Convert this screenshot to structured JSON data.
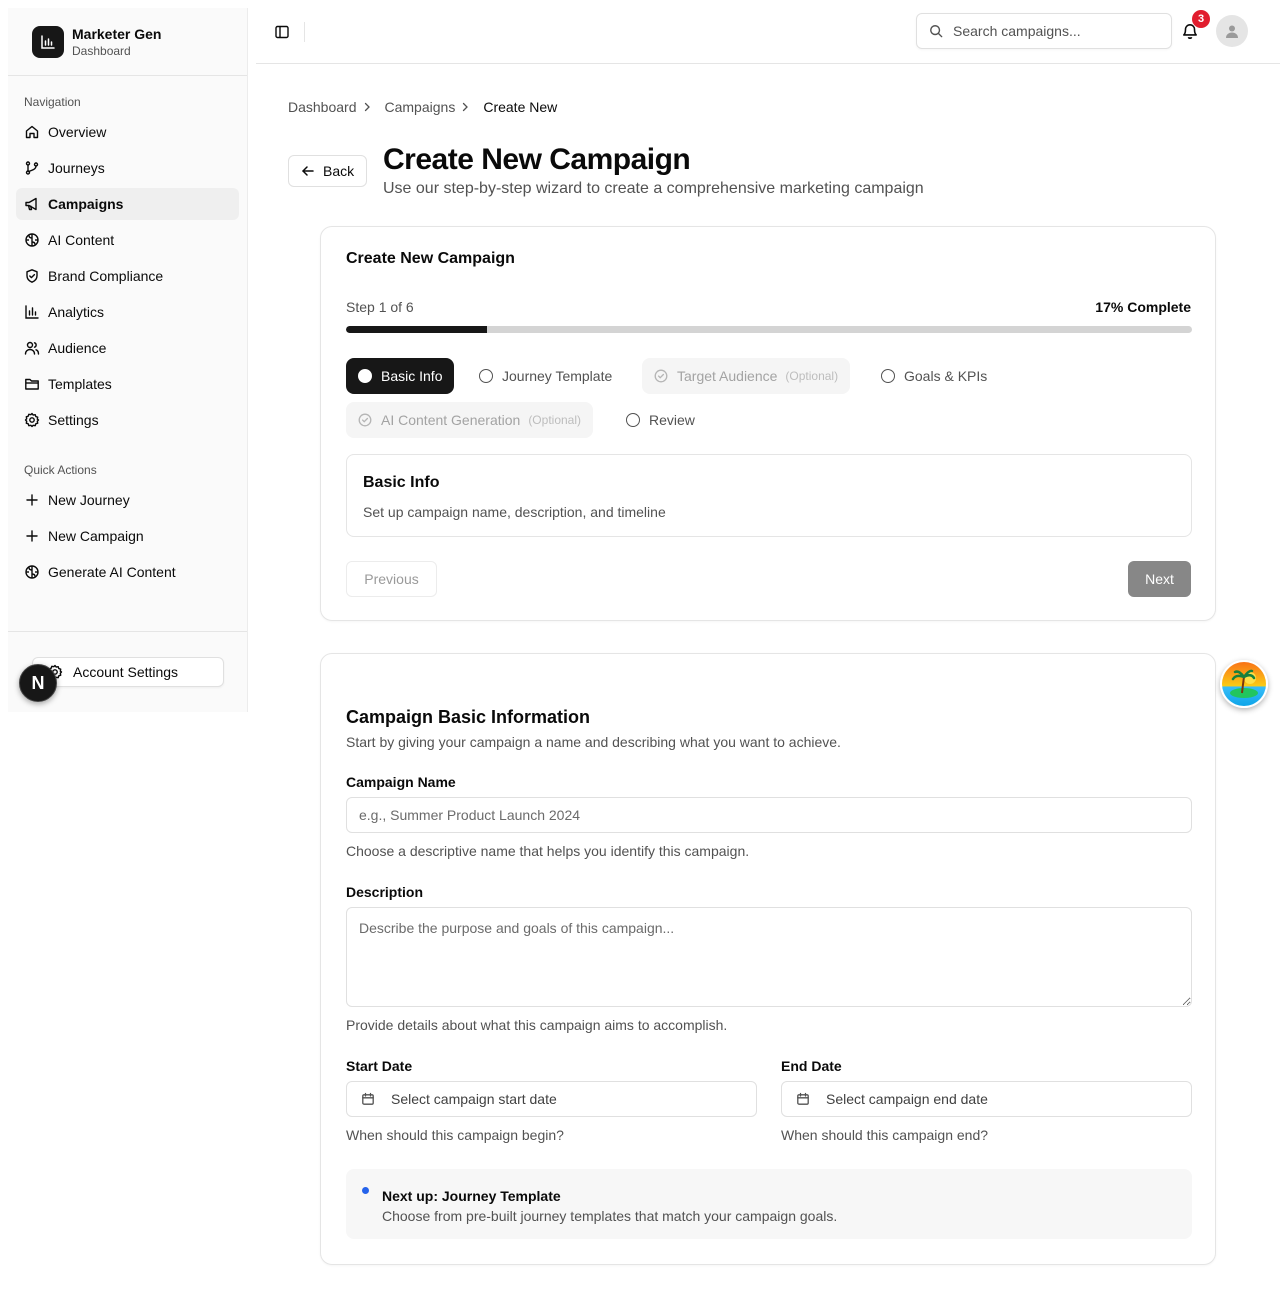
{
  "brand": {
    "name": "Marketer Gen",
    "subtitle": "Dashboard"
  },
  "sidebar": {
    "nav_label": "Navigation",
    "items": [
      {
        "label": "Overview",
        "icon": "home-icon"
      },
      {
        "label": "Journeys",
        "icon": "git-branch-icon"
      },
      {
        "label": "Campaigns",
        "icon": "megaphone-icon",
        "active": true
      },
      {
        "label": "AI Content",
        "icon": "brain-icon"
      },
      {
        "label": "Brand Compliance",
        "icon": "shield-check-icon"
      },
      {
        "label": "Analytics",
        "icon": "bar-chart-icon"
      },
      {
        "label": "Audience",
        "icon": "users-icon"
      },
      {
        "label": "Templates",
        "icon": "folder-icon"
      },
      {
        "label": "Settings",
        "icon": "gear-icon"
      }
    ],
    "quick_label": "Quick Actions",
    "quick_actions": [
      {
        "label": "New Journey",
        "icon": "plus-icon"
      },
      {
        "label": "New Campaign",
        "icon": "plus-icon"
      },
      {
        "label": "Generate AI Content",
        "icon": "brain-icon"
      }
    ],
    "account_settings": "Account Settings",
    "dev_badge": "N"
  },
  "header": {
    "search_placeholder": "Search campaigns...",
    "notification_count": "3"
  },
  "breadcrumb": {
    "items": [
      "Dashboard",
      "Campaigns"
    ],
    "current": "Create New"
  },
  "page": {
    "back_label": "Back",
    "title": "Create New Campaign",
    "subtitle": "Use our step-by-step wizard to create a comprehensive marketing campaign"
  },
  "wizard": {
    "title": "Create New Campaign",
    "step_text": "Step 1 of 6",
    "complete_text": "17% Complete",
    "progress_fraction": 0.167,
    "steps": [
      {
        "label": "Basic Info",
        "state": "active"
      },
      {
        "label": "Journey Template",
        "state": "pending"
      },
      {
        "label": "Target Audience",
        "state": "optional",
        "optional_label": "(Optional)"
      },
      {
        "label": "Goals & KPIs",
        "state": "pending"
      },
      {
        "label": "AI Content Generation",
        "state": "optional",
        "optional_label": "(Optional)"
      },
      {
        "label": "Review",
        "state": "pending"
      }
    ],
    "current_step": {
      "title": "Basic Info",
      "description": "Set up campaign name, description, and timeline"
    },
    "previous_label": "Previous",
    "next_label": "Next"
  },
  "form": {
    "title": "Campaign Basic Information",
    "description": "Start by giving your campaign a name and describing what you want to achieve.",
    "name_label": "Campaign Name",
    "name_placeholder": "e.g., Summer Product Launch 2024",
    "name_hint": "Choose a descriptive name that helps you identify this campaign.",
    "desc_label": "Description",
    "desc_placeholder": "Describe the purpose and goals of this campaign...",
    "desc_hint": "Provide details about what this campaign aims to accomplish.",
    "start_label": "Start Date",
    "start_placeholder": "Select campaign start date",
    "start_hint": "When should this campaign begin?",
    "end_label": "End Date",
    "end_placeholder": "Select campaign end date",
    "end_hint": "When should this campaign end?",
    "next_up_title": "Next up: Journey Template",
    "next_up_desc": "Choose from pre-built journey templates that match your campaign goals."
  },
  "colors": {
    "primary": "#171717",
    "muted": "#525252",
    "border": "#e5e5e5",
    "badge": "#e11d2e",
    "info_dot": "#2563eb"
  }
}
